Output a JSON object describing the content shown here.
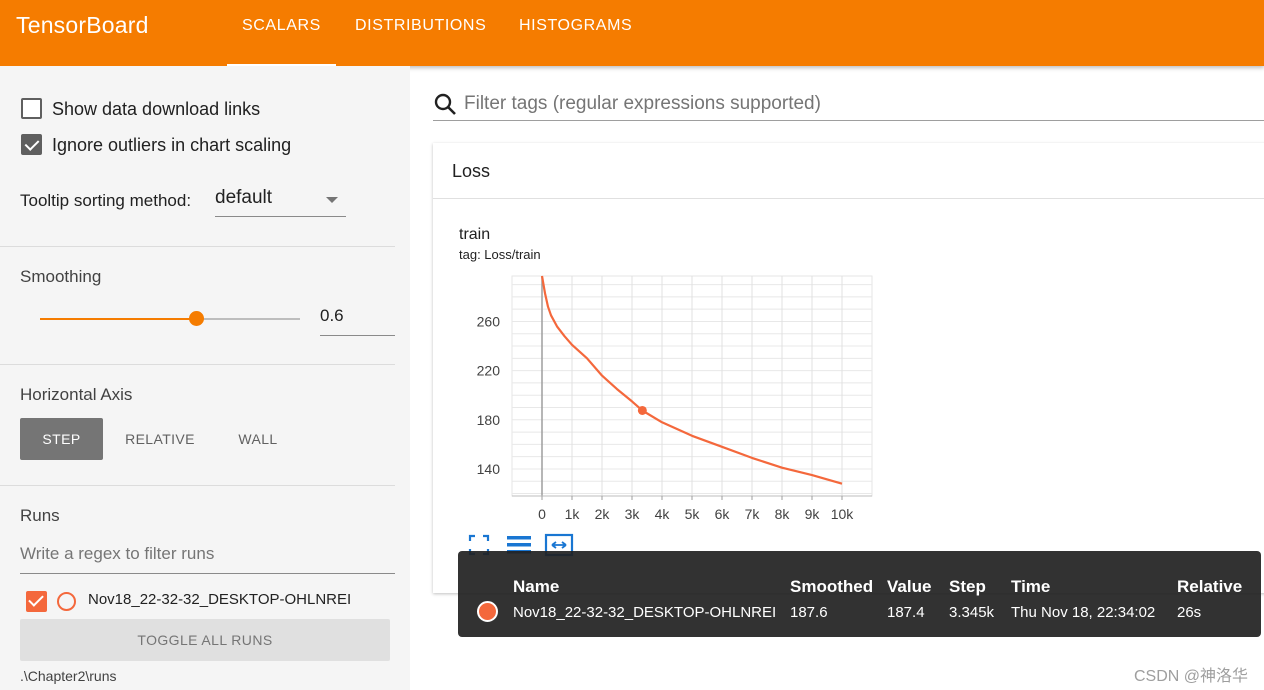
{
  "app": {
    "title": "TensorBoard",
    "tabs": [
      {
        "label": "SCALARS",
        "active": true
      },
      {
        "label": "DISTRIBUTIONS",
        "active": false
      },
      {
        "label": "HISTOGRAMS",
        "active": false
      }
    ]
  },
  "sidebar": {
    "show_download": {
      "label": "Show data download links",
      "checked": false
    },
    "ignore_outliers": {
      "label": "Ignore outliers in chart scaling",
      "checked": true
    },
    "tooltip_sorting": {
      "label": "Tooltip sorting method:",
      "value": "default"
    },
    "smoothing": {
      "title": "Smoothing",
      "value": "0.6",
      "fraction": 0.6
    },
    "horizontal_axis": {
      "title": "Horizontal Axis",
      "options": [
        {
          "label": "STEP",
          "active": true
        },
        {
          "label": "RELATIVE",
          "active": false
        },
        {
          "label": "WALL",
          "active": false
        }
      ]
    },
    "runs": {
      "title": "Runs",
      "filter_placeholder": "Write a regex to filter runs",
      "items": [
        {
          "name": "Nov18_22-32-32_DESKTOP-OHLNREI",
          "checked": true,
          "color": "#f4683c"
        }
      ],
      "toggle_label": "TOGGLE ALL RUNS",
      "logdir": ".\\Chapter2\\runs"
    }
  },
  "main": {
    "filter_placeholder": "Filter tags (regular expressions supported)",
    "card_title": "Loss",
    "chart_title": "train",
    "chart_tag": "tag: Loss/train"
  },
  "chart_data": {
    "type": "line",
    "title": "train",
    "subtitle": "tag: Loss/train",
    "xlabel": "",
    "ylabel": "",
    "x_ticks": [
      "0",
      "1k",
      "2k",
      "3k",
      "4k",
      "5k",
      "6k",
      "7k",
      "8k",
      "9k",
      "10k"
    ],
    "y_ticks": [
      "140",
      "180",
      "220",
      "260"
    ],
    "xlim": [
      -1000,
      11000
    ],
    "ylim": [
      118,
      297
    ],
    "grid": true,
    "series": [
      {
        "name": "Nov18_22-32-32_DESKTOP-OHLNREI",
        "color": "#f4683c",
        "x": [
          0,
          100,
          200,
          300,
          500,
          750,
          1000,
          1500,
          2000,
          2500,
          3000,
          3345,
          4000,
          5000,
          6000,
          7000,
          8000,
          9000,
          10000
        ],
        "y": [
          297,
          283,
          272,
          265,
          256,
          248,
          241,
          230,
          216,
          205,
          195,
          187.6,
          178,
          167,
          158,
          149,
          141,
          135,
          128
        ]
      }
    ],
    "highlight": {
      "x": 3345,
      "y": 187.6
    }
  },
  "tooltip": {
    "headers": [
      "Name",
      "Smoothed",
      "Value",
      "Step",
      "Time",
      "Relative"
    ],
    "row": [
      "Nov18_22-32-32_DESKTOP-OHLNREI",
      "187.6",
      "187.4",
      "3.345k",
      "Thu Nov 18, 22:34:02",
      "26s"
    ],
    "color": "#f4683c"
  },
  "colors": {
    "accent": "#f57c00",
    "series": "#f4683c"
  },
  "icons": [
    "search-icon",
    "fit-domain-icon",
    "toggle-log-icon",
    "expand-icon"
  ],
  "watermark": "CSDN @神洛华"
}
